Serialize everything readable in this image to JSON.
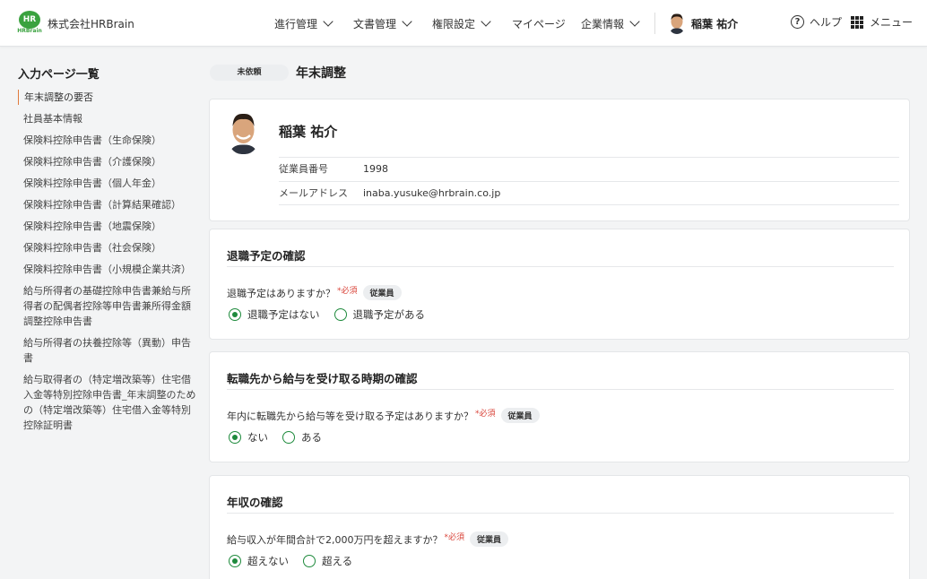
{
  "header": {
    "logo_text": "HR",
    "logo_sub": "HRBrain",
    "company": "株式会社HRBrain",
    "nav": [
      {
        "label": "進行管理"
      },
      {
        "label": "文書管理"
      },
      {
        "label": "権限設定"
      },
      {
        "label": "マイページ"
      },
      {
        "label": "企業情報"
      }
    ],
    "user_name": "稲葉 祐介",
    "help_label": "ヘルプ",
    "menu_label": "メニュー"
  },
  "sidebar": {
    "title": "入力ページ一覧",
    "items": [
      {
        "label": "年末調整の要否"
      },
      {
        "label": "社員基本情報"
      },
      {
        "label": "保険料控除申告書（生命保険）"
      },
      {
        "label": "保険料控除申告書（介護保険）"
      },
      {
        "label": "保険料控除申告書（個人年金）"
      },
      {
        "label": "保険料控除申告書（計算結果確認）"
      },
      {
        "label": "保険料控除申告書（地震保険）"
      },
      {
        "label": "保険料控除申告書（社会保険）"
      },
      {
        "label": "保険料控除申告書（小規模企業共済）"
      },
      {
        "label": "給与所得者の基礎控除申告書兼給与所得者の配偶者控除等申告書兼所得金額調整控除申告書"
      },
      {
        "label": "給与所得者の扶養控除等（異動）申告書"
      },
      {
        "label": "給与取得者の（特定増改築等）住宅借入金等特別控除申告書_年末調整のための（特定増改築等）住宅借入金等特別控除証明書"
      }
    ]
  },
  "main": {
    "status": "未依頼",
    "title": "年末調整",
    "profile": {
      "name": "稲葉 祐介",
      "employee_no_label": "従業員番号",
      "employee_no": "1998",
      "email_label": "メールアドレス",
      "email": "inaba.yusuke@hrbrain.co.jp"
    },
    "sections": [
      {
        "title": "退職予定の確認",
        "question": "退職予定はありますか？",
        "required": "*必須",
        "tag": "従業員",
        "options": [
          "退職予定はない",
          "退職予定がある"
        ]
      },
      {
        "title": "転職先から給与を受け取る時期の確認",
        "question": "年内に転職先から給与等を受け取る予定はありますか？",
        "required": "*必須",
        "tag": "従業員",
        "options": [
          "ない",
          "ある"
        ]
      },
      {
        "title": "年収の確認",
        "question": "給与収入が年間合計で2,000万円を超えますか？",
        "required": "*必須",
        "tag": "従業員",
        "options": [
          "超えない",
          "超える"
        ]
      }
    ]
  },
  "colors": {
    "brand_green": "#3aa23f",
    "radio_green": "#1e8a3c",
    "required_red": "#d9443a",
    "active_marker": "#e07b3c"
  }
}
